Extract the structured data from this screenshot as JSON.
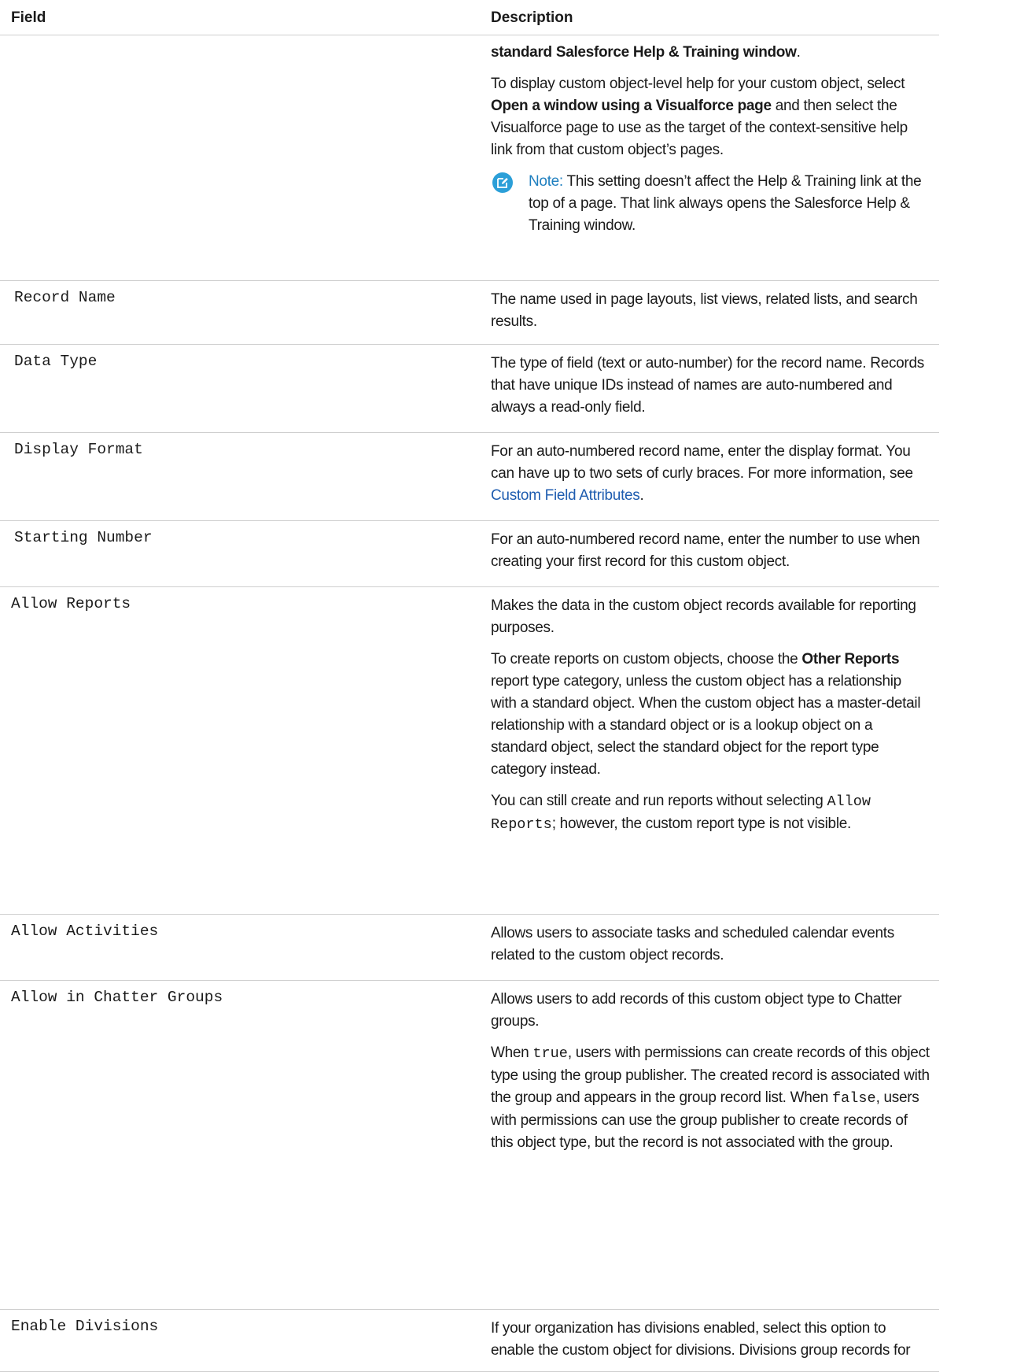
{
  "header": {
    "field": "Field",
    "description": "Description"
  },
  "top_row": {
    "p1_bold": "standard Salesforce Help & Training window",
    "p1_end": ".",
    "p2_a": "To display custom object-level help for your custom object, select ",
    "p2_bold": "Open a window using a Visualforce page",
    "p2_b": " and then select the Visualforce page to use as the target of the context-sensitive help link from that custom object’s pages.",
    "note_label": "Note:",
    "note_text": " This setting doesn’t affect the Help & Training link at the top of a page. That link always opens the Salesforce Help & Training window.",
    "note_icon": "edit-note-icon"
  },
  "rows": {
    "record_name": {
      "field": "Record Name",
      "desc": "The name used in page layouts, list views, related lists, and search results."
    },
    "data_type": {
      "field": "Data Type",
      "desc": "The type of field (text or auto-number) for the record name. Records that have unique IDs instead of names are auto-numbered and always a read-only field."
    },
    "display_format": {
      "field": "Display Format",
      "desc": "For an auto-numbered record name, enter the display format. You can have up to two sets of curly braces. For more information, see ",
      "link": "Custom Field Attributes",
      "end": "."
    },
    "starting_number": {
      "field": "Starting Number",
      "desc": "For an auto-numbered record name, enter the number to use when creating your first record for this custom object."
    },
    "allow_reports": {
      "field": "Allow Reports",
      "p1": "Makes the data in the custom object records available for reporting purposes.",
      "p2_a": "To create reports on custom objects, choose the ",
      "p2_bold": "Other Reports",
      "p2_b": " report type category, unless the custom object has a relationship with a standard object. When the custom object has a master-detail relationship with a standard object or is a lookup object on a standard object, select the standard object for the report type category instead.",
      "p3_a": "You can still create and run reports without selecting ",
      "p3_code": "Allow Reports",
      "p3_b": "; however, the custom report type is not visible."
    },
    "allow_activities": {
      "field": "Allow Activities",
      "desc": "Allows users to associate tasks and scheduled calendar events related to the custom object records."
    },
    "allow_chatter": {
      "field": "Allow in Chatter Groups",
      "p1": "Allows users to add records of this custom object type to Chatter groups.",
      "p2_a": "When ",
      "p2_code1": "true",
      "p2_b": ", users with permissions can create records of this object type using the group publisher. The created record is associated with the group and appears in the group record list. When ",
      "p2_code2": "false",
      "p2_c": ", users with permissions can use the group publisher to create records of this object type, but the record is not associated with the group."
    },
    "enable_divisions": {
      "field": "Enable Divisions",
      "desc": "If your organization has divisions enabled, select this option to enable the custom object for divisions. Divisions group records for"
    }
  }
}
